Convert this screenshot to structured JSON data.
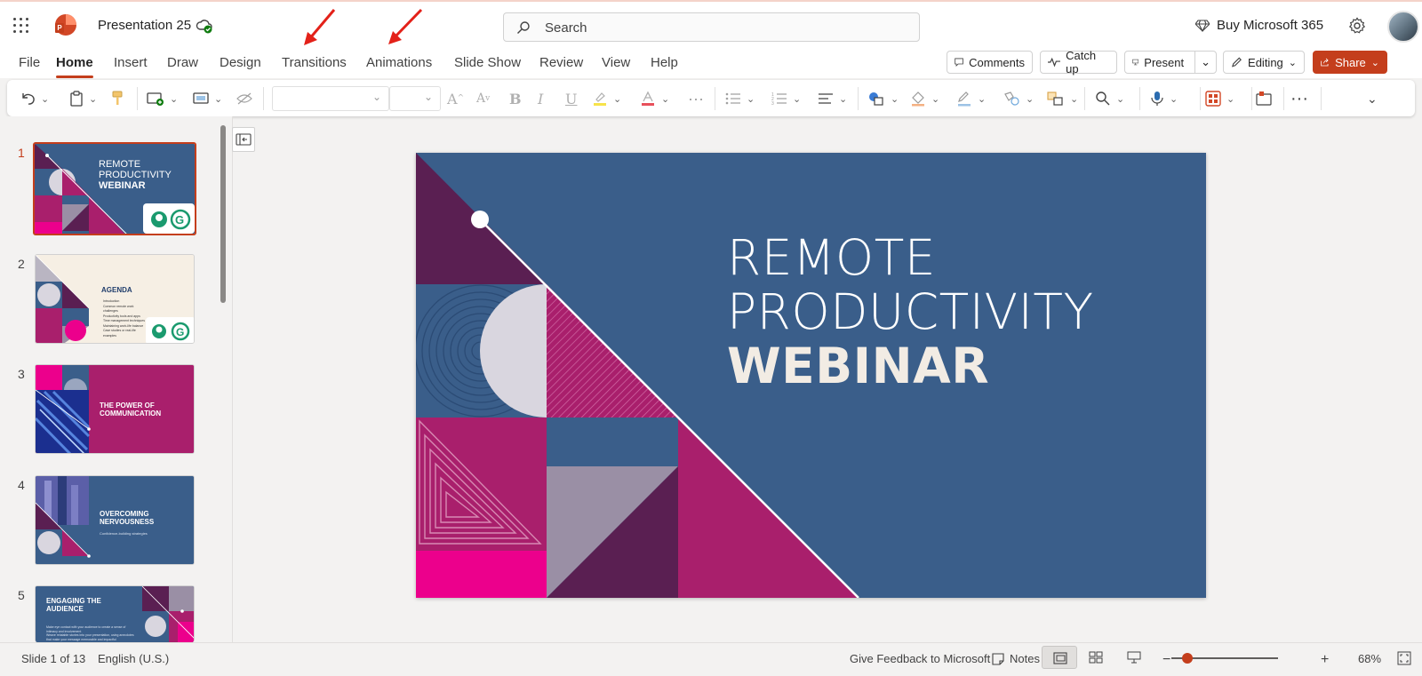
{
  "app": {
    "document_title": "Presentation 25",
    "search_placeholder": "Search",
    "buy_label": "Buy Microsoft 365"
  },
  "menu": {
    "tabs": [
      {
        "label": "File"
      },
      {
        "label": "Home"
      },
      {
        "label": "Insert"
      },
      {
        "label": "Draw"
      },
      {
        "label": "Design"
      },
      {
        "label": "Transitions"
      },
      {
        "label": "Animations"
      },
      {
        "label": "Slide Show"
      },
      {
        "label": "Review"
      },
      {
        "label": "View"
      },
      {
        "label": "Help"
      }
    ],
    "active_tab": "Home",
    "comments_label": "Comments",
    "catchup_label": "Catch up",
    "present_label": "Present",
    "editing_label": "Editing",
    "share_label": "Share"
  },
  "thumbnails": [
    {
      "number": "1",
      "line1": "REMOTE",
      "line2": "PRODUCTIVITY",
      "line3": "WEBINAR"
    },
    {
      "number": "2",
      "title": "AGENDA",
      "items": [
        "Introduction",
        "Common remote work challenges",
        "Productivity tools and apps",
        "Time management techniques",
        "Maintaining work-life balance",
        "Case studies or real-life examples"
      ]
    },
    {
      "number": "3",
      "title": "THE POWER OF COMMUNICATION"
    },
    {
      "number": "4",
      "title": "OVERCOMING NERVOUSNESS",
      "subtitle": "Confidence-building strategies"
    },
    {
      "number": "5",
      "title": "ENGAGING THE AUDIENCE",
      "body1": "Make eye contact with your audience to create a sense of intimacy and involvement",
      "body2": "Weave relatable stories into your presentation, using anecdotes that make your message memorable and impactful"
    }
  ],
  "slide": {
    "line1": "REMOTE",
    "line2": "PRODUCTIVITY",
    "line3": "WEBINAR"
  },
  "status": {
    "slide_counter": "Slide 1 of 13",
    "language": "English (U.S.)",
    "feedback": "Give Feedback to Microsoft",
    "notes": "Notes",
    "zoom": "68%"
  },
  "colors": {
    "accent": "#c43e1c",
    "slide_blue": "#3a5e8a",
    "magenta": "#a91f6c",
    "hot_pink": "#ec008c",
    "plum": "#5a1f52",
    "lavender": "#d9d6df",
    "annotation_red": "#e32119"
  }
}
